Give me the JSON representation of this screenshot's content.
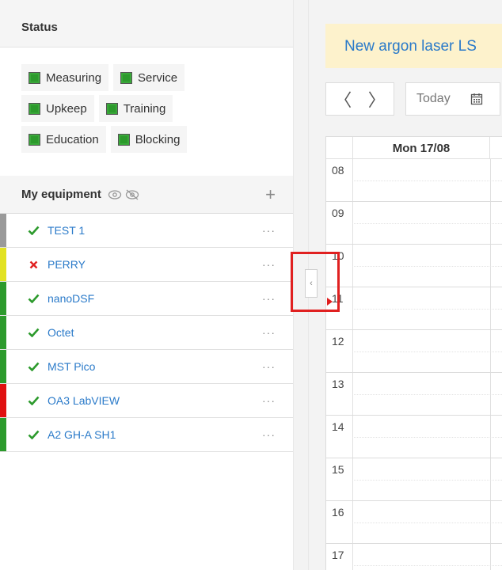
{
  "status": {
    "title": "Status",
    "rows": [
      [
        "Measuring",
        "Service"
      ],
      [
        "Upkeep",
        "Training"
      ],
      [
        "Education",
        "Blocking"
      ]
    ]
  },
  "equipment": {
    "title": "My equipment",
    "add_label": "+",
    "more_label": "···",
    "items": [
      {
        "name": "TEST 1",
        "color": "#9a9a9a",
        "state": "ok"
      },
      {
        "name": "PERRY",
        "color": "#e2e222",
        "state": "error"
      },
      {
        "name": "nanoDSF",
        "color": "#2c9a2c",
        "state": "ok"
      },
      {
        "name": "Octet",
        "color": "#2c9a2c",
        "state": "ok"
      },
      {
        "name": "MST Pico",
        "color": "#2c9a2c",
        "state": "ok"
      },
      {
        "name": "OA3 LabVIEW",
        "color": "#e01010",
        "state": "ok"
      },
      {
        "name": "A2 GH-A SH1",
        "color": "#2c9a2c",
        "state": "ok"
      }
    ]
  },
  "collapse": {
    "icon": "‹"
  },
  "calendar": {
    "title": "New argon laser LS",
    "prev": "〈",
    "next": "〉",
    "today_label": "Today",
    "day_header": "Mon 17/08",
    "hours": [
      "08",
      "09",
      "10",
      "11",
      "12",
      "13",
      "14",
      "15",
      "16",
      "17"
    ]
  },
  "colors": {
    "accent": "#2a7ac9",
    "ok": "#2c9a2c",
    "error": "#e02020",
    "banner": "#fdf2cc"
  }
}
